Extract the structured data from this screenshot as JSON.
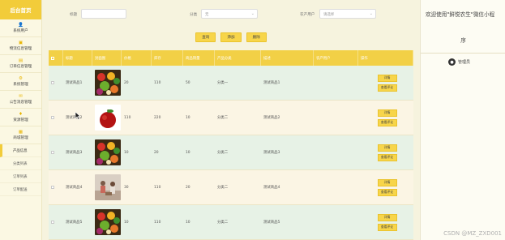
{
  "sidebar": {
    "brand": "后台首页",
    "items": [
      {
        "label": "系统用户",
        "icon": "user-icon",
        "glyph": "👤"
      },
      {
        "label": "物流信息管理",
        "icon": "truck-icon",
        "glyph": "▣"
      },
      {
        "label": "订单信息管理",
        "icon": "order-icon",
        "glyph": "▤"
      },
      {
        "label": "系统管理",
        "icon": "gear-icon",
        "glyph": "⚙"
      },
      {
        "label": "公告消息管理",
        "icon": "notice-icon",
        "glyph": "✉"
      },
      {
        "label": "资源管理",
        "icon": "resource-icon",
        "glyph": "♦"
      },
      {
        "label": "商城管理",
        "icon": "shop-icon",
        "glyph": "▦"
      }
    ],
    "subitems": [
      "产品信息",
      "分类列表",
      "订单列表",
      "订单配送"
    ]
  },
  "filters": {
    "name_label": "标题",
    "name_value": "",
    "category_label": "分类",
    "category_value": "无",
    "farmer_label": "农产用户",
    "farmer_placeholder": "请选择"
  },
  "actions": {
    "query": "查询",
    "add": "添加",
    "delete": "删除"
  },
  "table": {
    "headers": [
      "标题",
      "封面图",
      "价格",
      "库存",
      "商品销量",
      "产品分类",
      "描述",
      "农产用户",
      "操作"
    ],
    "rows": [
      {
        "title": "测试商品1",
        "price": "20",
        "stock": "110",
        "sales": "50",
        "category": "分类一",
        "desc": "测试商品1",
        "farmer": "",
        "img": "veg"
      },
      {
        "title": "测试商品2",
        "price": "110",
        "stock": "220",
        "sales": "10",
        "category": "分类二",
        "desc": "测试商品2",
        "farmer": "",
        "img": "apple"
      },
      {
        "title": "测试商品3",
        "price": "10",
        "stock": "20",
        "sales": "10",
        "category": "分类二",
        "desc": "测试商品3",
        "farmer": "",
        "img": "veg"
      },
      {
        "title": "测试商品4",
        "price": "30",
        "stock": "110",
        "sales": "20",
        "category": "分类二",
        "desc": "测试商品4",
        "farmer": "",
        "img": "people"
      },
      {
        "title": "测试商品5",
        "price": "10",
        "stock": "110",
        "sales": "10",
        "category": "分类二",
        "desc": "测试商品5",
        "farmer": "",
        "img": "veg"
      }
    ],
    "op_detail": "详情",
    "op_review": "查看评论"
  },
  "rpanel": {
    "welcome": "欢迎使用\"鲜悦农生\"微信小程",
    "welcome2": "序",
    "admin": "管理员"
  },
  "watermark": "CSDN @MZ_ZXD001",
  "colors": {
    "accent": "#f2cc3a",
    "button": "#f7d54a",
    "row_odd": "#e7f2e6",
    "row_even": "#fbf5e4"
  }
}
